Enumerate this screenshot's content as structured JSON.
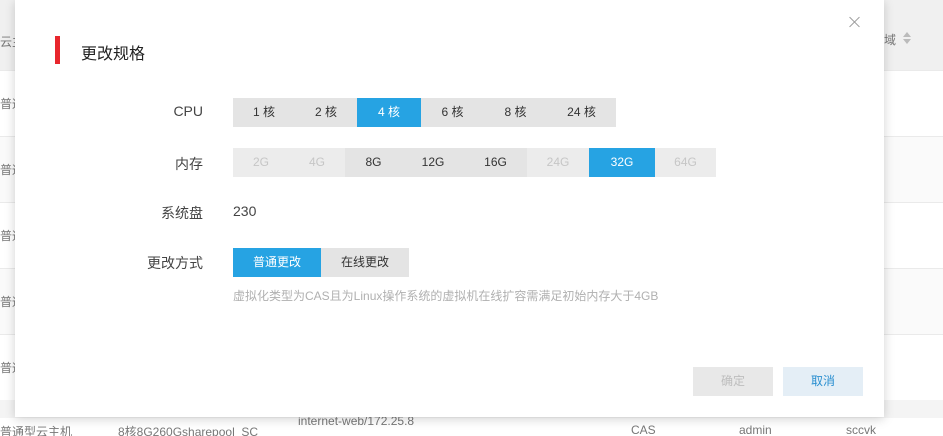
{
  "background": {
    "header_left_text": "云主",
    "header_right_text": "域",
    "row_labels": [
      "普通",
      "普通",
      "普通",
      "普通",
      "普通"
    ],
    "last_row": {
      "name": "普通型云主机",
      "spec": "8核8G260Gsharepool_SC",
      "network": "internet-web/172.25.8",
      "type": "CAS",
      "owner": "admin",
      "domain": "sccvk"
    }
  },
  "modal": {
    "title": "更改规格",
    "cpu": {
      "label": "CPU",
      "options": [
        {
          "label": "1 核",
          "state": "normal"
        },
        {
          "label": "2 核",
          "state": "normal"
        },
        {
          "label": "4 核",
          "state": "active"
        },
        {
          "label": "6 核",
          "state": "normal"
        },
        {
          "label": "8 核",
          "state": "normal"
        },
        {
          "label": "24 核",
          "state": "normal"
        }
      ]
    },
    "memory": {
      "label": "内存",
      "options": [
        {
          "label": "2G",
          "state": "disabled"
        },
        {
          "label": "4G",
          "state": "disabled"
        },
        {
          "label": "8G",
          "state": "normal"
        },
        {
          "label": "12G",
          "state": "normal"
        },
        {
          "label": "16G",
          "state": "normal"
        },
        {
          "label": "24G",
          "state": "disabled"
        },
        {
          "label": "32G",
          "state": "active"
        },
        {
          "label": "64G",
          "state": "disabled"
        }
      ]
    },
    "disk": {
      "label": "系统盘",
      "value": "230"
    },
    "mode": {
      "label": "更改方式",
      "options": [
        {
          "label": "普通更改",
          "state": "active"
        },
        {
          "label": "在线更改",
          "state": "normal"
        }
      ],
      "hint": "虚拟化类型为CAS且为Linux操作系统的虚拟机在线扩容需满足初始内存大于4GB"
    },
    "ok_label": "确定",
    "cancel_label": "取消"
  }
}
